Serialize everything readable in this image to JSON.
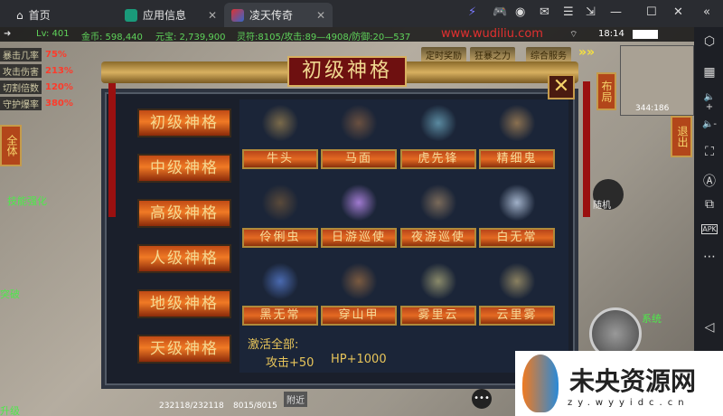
{
  "tabs": [
    {
      "label": "首页"
    },
    {
      "label": "应用信息"
    },
    {
      "label": "凌天传奇"
    }
  ],
  "window_controls": [
    "⚡",
    "🎮",
    "◉",
    "✉",
    "☰",
    "⇲",
    "—",
    "☐",
    "✕",
    "«"
  ],
  "status": {
    "level": "Lv: 401",
    "gold": "金币: 598,440",
    "yuanbao": "元宝: 2,739,900",
    "attrs": "灵符:8105/攻击:89—4908/防御:20—537",
    "site": "www.wudiliu.com",
    "time": "18:14"
  },
  "stats": [
    {
      "k": "暴击几率",
      "v": "75%"
    },
    {
      "k": "攻击伤害",
      "v": "213%"
    },
    {
      "k": "切割倍数",
      "v": "120%"
    },
    {
      "k": "守护爆率",
      "v": "380%"
    }
  ],
  "top_buttons": [
    "定时奖励",
    "狂暴之力",
    "综合服务"
  ],
  "panel": {
    "title": "初级神格",
    "close": "✕",
    "tiers": [
      "初级神格",
      "中级神格",
      "高级神格",
      "人级神格",
      "地级神格",
      "天级神格"
    ],
    "cards": [
      "牛头",
      "马面",
      "虎先锋",
      "精细鬼",
      "伶俐虫",
      "日游巡使",
      "夜游巡使",
      "白无常",
      "黑无常",
      "穿山甲",
      "雾里云",
      "云里雾"
    ],
    "activate_label": "激活全部:",
    "bonus_attack": "攻击+50",
    "bonus_hp": "HP+1000"
  },
  "side_left": {
    "all": "全体",
    "skill": "技能强化",
    "breakthrough": "突破",
    "upgrade": "升级"
  },
  "side_right": {
    "layout": "布局",
    "exit": "退出",
    "random": "随机",
    "system": "系统",
    "coords": "344:186"
  },
  "bottom": {
    "hp": "232118/232118",
    "mp": "8015/8015",
    "nearby": "附近"
  },
  "watermark": {
    "name": "未央资源网",
    "url": "zy.wyyidc.cn"
  },
  "emulator_sidebar": [
    "⬡",
    "▦",
    "🔈+",
    "🔈-",
    "⛶",
    "Ⓐ",
    "⧉",
    "APK",
    "⋯",
    "◁"
  ]
}
